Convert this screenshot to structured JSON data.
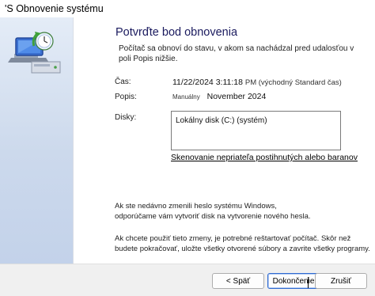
{
  "window": {
    "title": "'S Obnovenie systému"
  },
  "page": {
    "heading": "Potvrďte bod obnovenia",
    "description": "Počítač sa obnoví do stavu, v akom sa nachádzal pred udalosťou v poli Popis nižšie.",
    "time_label": "Čas:",
    "time_value": "11/22/2024 3:11:18",
    "time_zone": "PM (východný Standard čas)",
    "description_label": "Popis:",
    "description_type": "Manuálny",
    "description_value": "November 2024",
    "drives_label": "Disky:",
    "drives": [
      "Lokálny disk (C:) (systém)"
    ],
    "scan_link": "Skenovanie nepriateľa postihnutých alebo baranov",
    "password_note": "Ak ste nedávno zmenili heslo systému Windows, odporúčame vám vytvoriť disk na vytvorenie nového hesla.",
    "restart_note": "Ak chcete použiť tieto zmeny, je potrebné reštartovať počítač. Skôr než budete pokračovať, uložte všetky otvorené súbory a zavrite všetky programy."
  },
  "buttons": {
    "back": "< Späť",
    "finish": "Dokončenie",
    "cancel": "Zrušiť"
  }
}
